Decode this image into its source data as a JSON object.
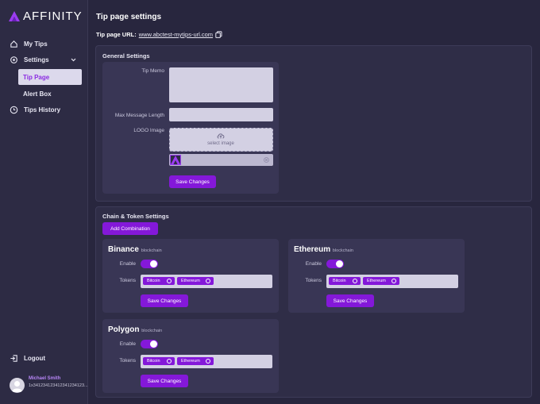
{
  "sidebar": {
    "brand": "AFFINITY",
    "items": [
      {
        "label": "My Tips"
      },
      {
        "label": "Settings"
      },
      {
        "label": "Tips History"
      },
      {
        "label": "Logout"
      }
    ],
    "sub_items": [
      {
        "label": "Tip Page"
      },
      {
        "label": "Alert Box"
      }
    ],
    "user": {
      "name": "Michael Smith",
      "id": "1x341234123412341234123..."
    }
  },
  "main": {
    "title": "Tip page settings",
    "url_label": "Tip page URL:",
    "url": "www.abctest-mytips-url.com",
    "general": {
      "title": "General Settings",
      "tip_memo_label": "Tip Memo",
      "max_message_label": "Max Message Length",
      "logo_label": "LOGO Image",
      "select_image": "select image",
      "save": "Save Changes"
    },
    "chain": {
      "title": "Chain & Token Settings",
      "add": "Add Combination",
      "blocks": [
        {
          "name": "Binance",
          "suffix": "blockchain",
          "enable_label": "Enable",
          "tokens_label": "Tokens",
          "tokens": [
            "Bitcoin",
            "Ethereum"
          ],
          "enabled": true,
          "save": "Save Changes"
        },
        {
          "name": "Ethereum",
          "suffix": "blockchain",
          "enable_label": "Enable",
          "tokens_label": "Tokens",
          "tokens": [
            "Bitcoin",
            "Ethereum"
          ],
          "enabled": true,
          "save": "Save Changes"
        },
        {
          "name": "Polygon",
          "suffix": "blockchain",
          "enable_label": "Enable",
          "tokens_label": "Tokens",
          "tokens": [
            "Bitcoin",
            "Ethereum"
          ],
          "enabled": true,
          "save": "Save Changes"
        }
      ]
    }
  },
  "colors": {
    "accent": "#8418d9",
    "active_text": "#8b2be2",
    "background": "#28263e"
  }
}
